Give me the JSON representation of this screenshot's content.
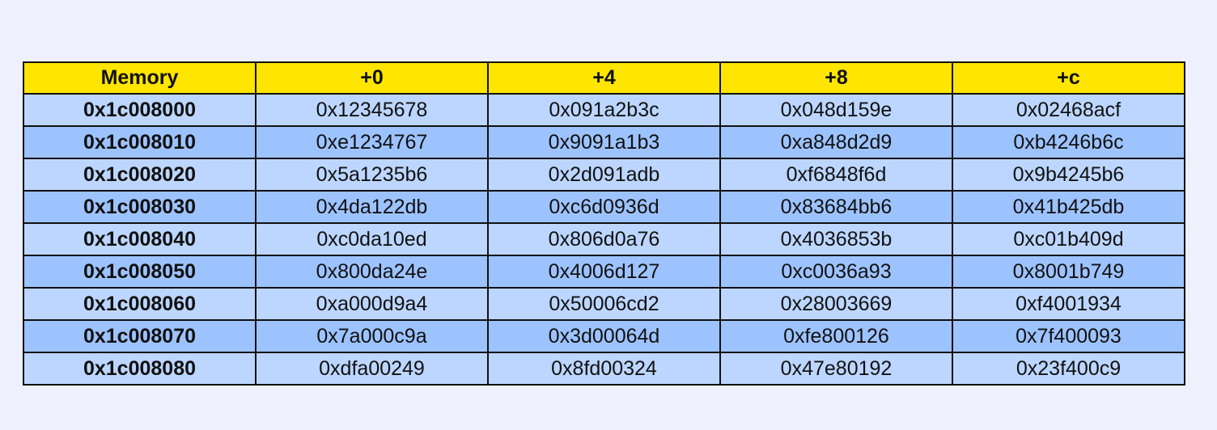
{
  "colors": {
    "header_bg": "#ffe500",
    "row_light": "#bcd6ff",
    "row_dark": "#9dc3ff",
    "page_bg": "#eef0fd"
  },
  "table": {
    "headers": [
      "Memory",
      "+0",
      "+4",
      "+8",
      "+c"
    ],
    "rows": [
      [
        "0x1c008000",
        "0x12345678",
        "0x091a2b3c",
        "0x048d159e",
        "0x02468acf"
      ],
      [
        "0x1c008010",
        "0xe1234767",
        "0x9091a1b3",
        "0xa848d2d9",
        "0xb4246b6c"
      ],
      [
        "0x1c008020",
        "0x5a1235b6",
        "0x2d091adb",
        "0xf6848f6d",
        "0x9b4245b6"
      ],
      [
        "0x1c008030",
        "0x4da122db",
        "0xc6d0936d",
        "0x83684bb6",
        "0x41b425db"
      ],
      [
        "0x1c008040",
        "0xc0da10ed",
        "0x806d0a76",
        "0x4036853b",
        "0xc01b409d"
      ],
      [
        "0x1c008050",
        "0x800da24e",
        "0x4006d127",
        "0xc0036a93",
        "0x8001b749"
      ],
      [
        "0x1c008060",
        "0xa000d9a4",
        "0x50006cd2",
        "0x28003669",
        "0xf4001934"
      ],
      [
        "0x1c008070",
        "0x7a000c9a",
        "0x3d00064d",
        "0xfe800126",
        "0x7f400093"
      ],
      [
        "0x1c008080",
        "0xdfa00249",
        "0x8fd00324",
        "0x47e80192",
        "0x23f400c9"
      ]
    ]
  }
}
